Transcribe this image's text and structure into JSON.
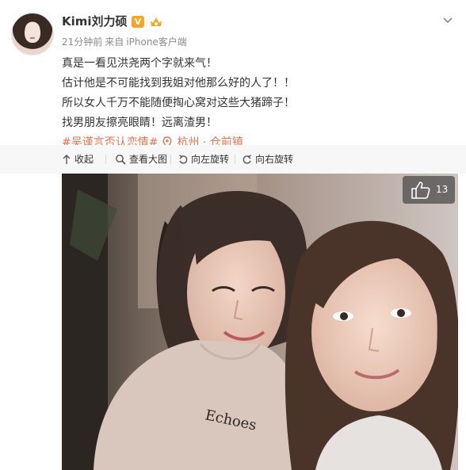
{
  "user": {
    "name": "Kimi刘力硕",
    "verified_badge": "V"
  },
  "meta": {
    "time": "21分钟前",
    "source_prefix": "来自",
    "source": "iPhone客户端"
  },
  "post": {
    "lines": [
      "真是一看见洪尧两个字就来气！",
      "估计他是不可能找到我姐对他那么好的人了！！",
      "所以女人千万不能随便掏心窝对这些大猪蹄子！",
      "找男朋友擦亮眼睛！远离渣男！"
    ],
    "topic": "#吴谨言否认恋情#",
    "location": "杭州 · 仓前镇"
  },
  "toolbar": {
    "collapse": "收起",
    "view_large": "查看大图",
    "rotate_left": "向左旋转",
    "rotate_right": "向右旋转"
  },
  "image": {
    "like_count": "13",
    "shirt_text": "Echoes"
  },
  "colors": {
    "link": "#eb7350",
    "meta": "#8c8c8c",
    "toolbar_bg": "#f7f7f7",
    "badge": "#f6a623"
  },
  "icons": {
    "verified": "verified-v-icon",
    "member": "member-crown-icon",
    "more": "chevron-down-icon",
    "location": "location-pin-icon",
    "collapse": "arrow-up-icon",
    "view_large": "magnifier-icon",
    "rotate_left": "rotate-left-icon",
    "rotate_right": "rotate-right-icon",
    "like": "thumbs-up-icon"
  }
}
